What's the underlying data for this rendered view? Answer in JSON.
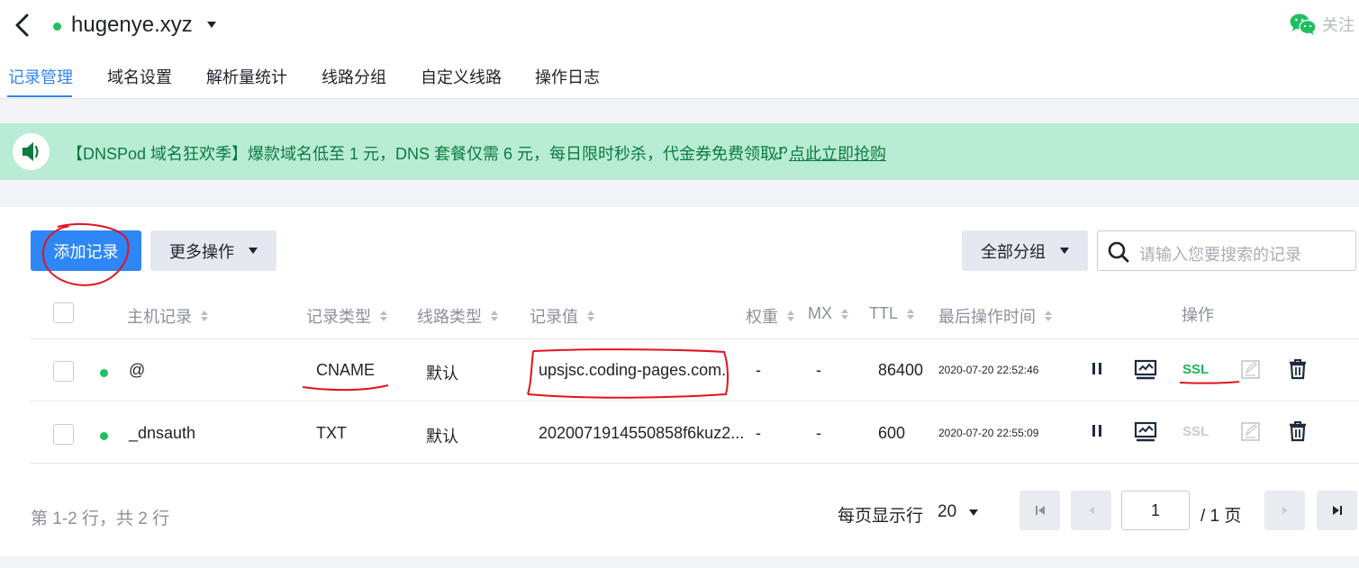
{
  "header": {
    "domain": "hugenye.xyz",
    "follow_label": "关注",
    "tabs": [
      {
        "label": "记录管理",
        "active": true
      },
      {
        "label": "域名设置"
      },
      {
        "label": "解析量统计"
      },
      {
        "label": "线路分组"
      },
      {
        "label": "自定义线路"
      },
      {
        "label": "操作日志"
      }
    ]
  },
  "banner": {
    "text": "【DNSPod 域名狂欢季】爆款域名低至 1 元，DNS 套餐仅需 6 元，每日限时秒杀，代金券免费领取！",
    "link": "点此立即抢购"
  },
  "toolbar": {
    "add_record": "添加记录",
    "more_actions": "更多操作",
    "all_groups": "全部分组",
    "search_placeholder": "请输入您要搜索的记录"
  },
  "table": {
    "headers": {
      "host": "主机记录",
      "type": "记录类型",
      "line": "线路类型",
      "value": "记录值",
      "weight": "权重",
      "mx": "MX",
      "ttl": "TTL",
      "updated": "最后操作时间",
      "actions": "操作"
    },
    "rows": [
      {
        "host": "@",
        "type": "CNAME",
        "line": "默认",
        "value": "upsjsc.coding-pages.com.",
        "weight": "-",
        "mx": "-",
        "ttl": "86400",
        "updated": "2020-07-20 22:52:46",
        "ssl": "SSL",
        "ssl_enabled": true
      },
      {
        "host": "_dnsauth",
        "type": "TXT",
        "line": "默认",
        "value": "2020071914550858f6kuz2...",
        "weight": "-",
        "mx": "-",
        "ttl": "600",
        "updated": "2020-07-20 22:55:09",
        "ssl": "SSL",
        "ssl_enabled": false
      }
    ]
  },
  "pagination": {
    "summary": "第 1-2 行，共 2 行",
    "per_page_label": "每页显示行",
    "per_page": "20",
    "current_page": "1",
    "total_pages_label": "/ 1 页"
  },
  "colors": {
    "accent": "#2f86f6",
    "status_green": "#1fbf5f",
    "banner_bg": "#b9ecd4",
    "ssl_green": "#17b85a",
    "annotation_red": "#e0141e"
  },
  "icons": [
    "back-icon",
    "dropdown-caret-icon",
    "wechat-icon",
    "speaker-icon",
    "link-icon",
    "search-icon",
    "sort-icon",
    "pause-icon",
    "monitor-icon",
    "edit-icon",
    "trash-icon",
    "first-page-icon",
    "prev-page-icon",
    "next-page-icon",
    "last-page-icon"
  ]
}
